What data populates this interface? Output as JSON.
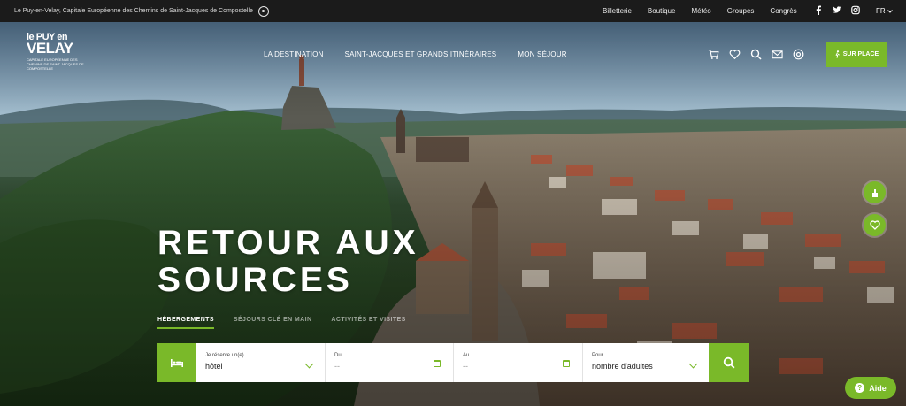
{
  "topbar": {
    "tagline": "Le Puy-en-Velay, Capitale Européenne des Chemins de Saint-Jacques de Compostelle",
    "links": [
      "Billetterie",
      "Boutique",
      "Météo",
      "Groupes",
      "Congrès"
    ],
    "social_icons": [
      "facebook-icon",
      "twitter-icon",
      "instagram-icon"
    ],
    "language": "FR"
  },
  "logo": {
    "line1": "le PUY en",
    "line2": "VELAY",
    "line3": "CAPITALE EUROPÉENNE DES CHEMINS DE SAINT-JACQUES DE COMPOSTELLE"
  },
  "nav": {
    "items": [
      "LA DESTINATION",
      "SAINT-JACQUES ET GRANDS ITINÉRAIRES",
      "MON SÉJOUR"
    ],
    "icons": [
      "cart-icon",
      "heart-icon",
      "search-icon",
      "mail-icon",
      "location-pin-icon"
    ],
    "cta": "SUR PLACE"
  },
  "hero": {
    "headline_line1": "RETOUR AUX",
    "headline_line2": "SOURCES"
  },
  "booking": {
    "tabs": [
      "HÉBERGEMENTS",
      "SÉJOURS CLÉ EN MAIN",
      "ACTIVITÉS ET VISITES"
    ],
    "active_tab": 0,
    "type_label": "Je réserve un(e)",
    "type_value": "hôtel",
    "from_label": "Du",
    "from_value": "--",
    "to_label": "Au",
    "to_value": "--",
    "guests_label": "Pour",
    "guests_value": "nombre d'adultes"
  },
  "aide": {
    "label": "Aide"
  },
  "colors": {
    "accent": "#7ab929",
    "topbar": "#1b1b1b"
  }
}
